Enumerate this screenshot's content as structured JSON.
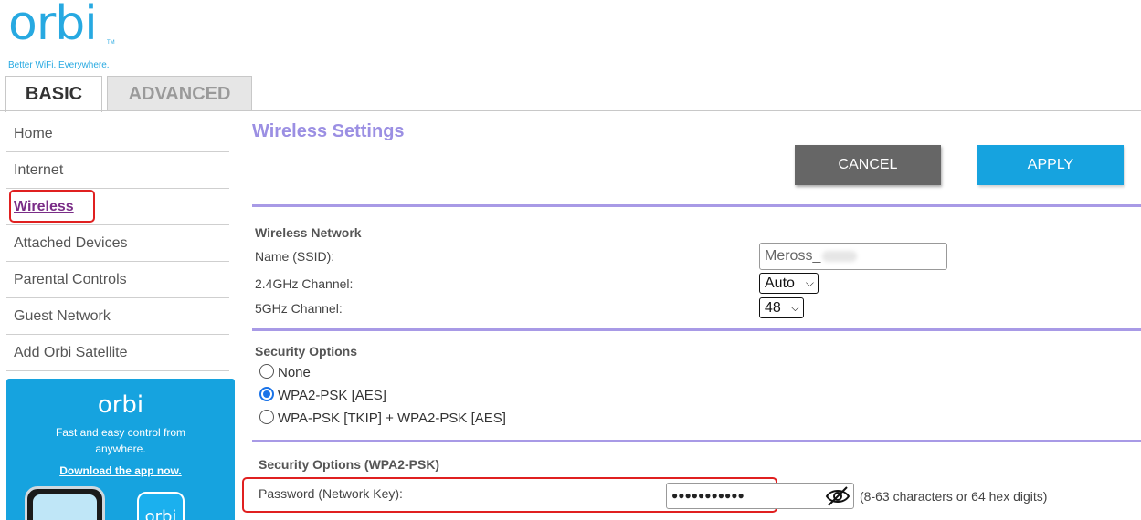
{
  "brand": {
    "logo": "orbi",
    "tm": "TM",
    "tagline": "Better WiFi. Everywhere."
  },
  "tabs": [
    {
      "label": "BASIC",
      "active": true
    },
    {
      "label": "ADVANCED",
      "active": false
    }
  ],
  "sidebar": {
    "items": [
      {
        "label": "Home"
      },
      {
        "label": "Internet"
      },
      {
        "label": "Wireless",
        "active": true
      },
      {
        "label": "Attached Devices"
      },
      {
        "label": "Parental Controls"
      },
      {
        "label": "Guest Network"
      },
      {
        "label": "Add Orbi Satellite"
      }
    ]
  },
  "promo": {
    "logo": "orbi",
    "text": "Fast and easy control from anywhere.",
    "link": "Download the app now.",
    "app_icon_text": "orbi"
  },
  "main": {
    "title": "Wireless Settings",
    "cancel_label": "CANCEL",
    "apply_label": "APPLY",
    "wireless_network": {
      "heading": "Wireless Network",
      "ssid_label": "Name (SSID):",
      "ssid_value": "Meross_",
      "channel24_label": "2.4GHz Channel:",
      "channel24_value": "Auto",
      "channel5_label": "5GHz Channel:",
      "channel5_value": "48"
    },
    "security": {
      "heading": "Security Options",
      "options": [
        {
          "label": "None",
          "checked": false
        },
        {
          "label": "WPA2-PSK [AES]",
          "checked": true
        },
        {
          "label": "WPA-PSK [TKIP] + WPA2-PSK [AES]",
          "checked": false
        }
      ]
    },
    "wpa2": {
      "heading": "Security Options (WPA2-PSK)",
      "password_label": "Password (Network Key):",
      "password_value": "●●●●●●●●●●●",
      "hint": "(8-63 characters or 64 hex digits)"
    }
  },
  "colors": {
    "brand_blue": "#16a3df",
    "title_purple": "#9b8fe3",
    "active_nav": "#7a2d87",
    "highlight_red": "#e02020",
    "cancel_gray": "#666666"
  }
}
